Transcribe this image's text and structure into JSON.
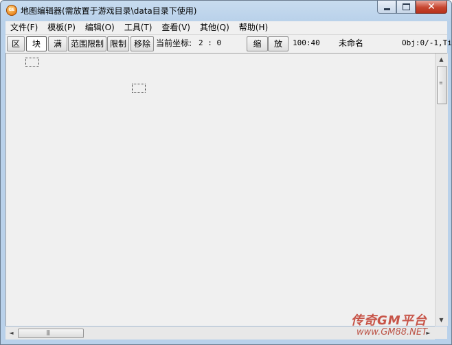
{
  "window": {
    "title": "地图编辑器(需放置于游戏目录\\data目录下使用)",
    "icon_text": "GE"
  },
  "menu": [
    {
      "label": "文件(F)"
    },
    {
      "label": "模板(P)"
    },
    {
      "label": "编辑(O)"
    },
    {
      "label": "工具(T)"
    },
    {
      "label": "查看(V)"
    },
    {
      "label": "其他(Q)"
    },
    {
      "label": "帮助(H)"
    }
  ],
  "toolbar": {
    "btn_zone": "区",
    "btn_block": "块",
    "btn_full": "满",
    "btn_range_limit": "范围限制",
    "btn_limit": "限制",
    "btn_remove": "移除",
    "coord_label": "当前坐标:",
    "coord_value": "2 : 0",
    "btn_shrink": "缩",
    "btn_enlarge": "放",
    "zoom": "100:40",
    "map_name": "未命名",
    "obj_info": "Obj:0/-1,Ti"
  },
  "scrollbar": {
    "left_arrow": "◄",
    "right_arrow": "►",
    "up_arrow": "▲",
    "down_arrow": "▼",
    "grip": "|||"
  },
  "watermark": {
    "main": "传奇GM平台",
    "sub": "www.GM88.NET"
  },
  "colors": {
    "frame": "#b9d1ea",
    "client": "#f0f0f0",
    "close_button": "#c6452f",
    "watermark": "#c0392b"
  }
}
